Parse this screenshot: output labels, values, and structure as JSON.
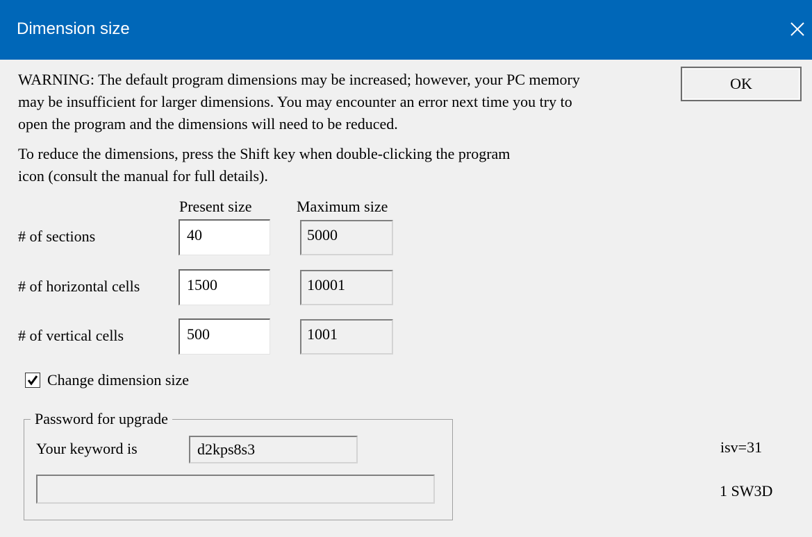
{
  "window": {
    "title": "Dimension size",
    "close_icon": "close-icon"
  },
  "warning": {
    "line1": "WARNING: The default program dimensions may be increased; however, your PC memory",
    "line2": "may be insufficient for larger dimensions. You may encounter an error next time you try to",
    "line3": "open the program and the dimensions will need to be reduced."
  },
  "reduce_note": {
    "line1": "To reduce the dimensions, press the Shift key when double-clicking the program",
    "line2": "icon (consult the manual for full details)."
  },
  "ok_label": "OK",
  "columns": {
    "present": "Present size",
    "maximum": "Maximum size"
  },
  "rows": [
    {
      "label": "# of sections",
      "present": "40",
      "maximum": "5000"
    },
    {
      "label": "# of horizontal cells",
      "present": "1500",
      "maximum": "10001"
    },
    {
      "label": "# of vertical cells",
      "present": "500",
      "maximum": "1001"
    }
  ],
  "change_checkbox": {
    "label": "Change dimension size",
    "checked": true
  },
  "password_group": {
    "legend": "Password for upgrade",
    "keyword_label": "Your keyword is",
    "keyword_value": "d2kps8s3",
    "password_value": ""
  },
  "info": {
    "isv": "isv=31",
    "product": "1 SW3D"
  }
}
